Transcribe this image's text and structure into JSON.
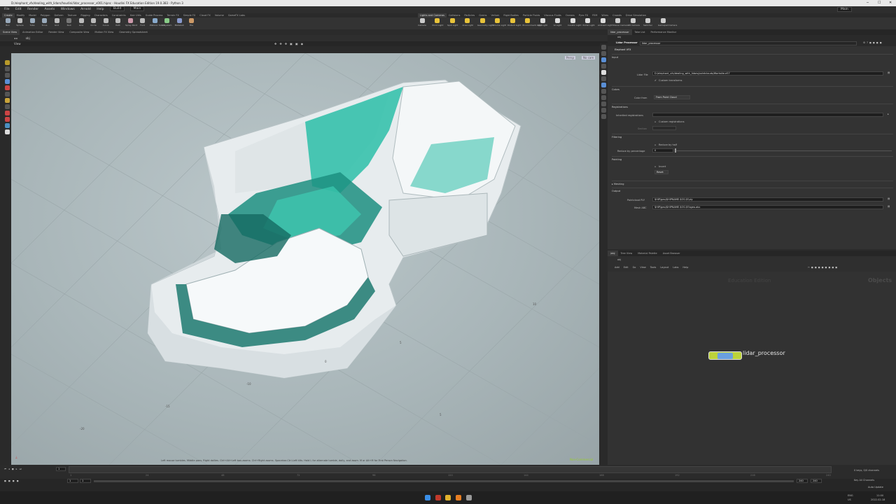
{
  "titlebar": {
    "title": "D:/elephant_vfx/dealing_with_lidars/houdini/lidar_processor_v001.hipnc - Houdini FX Education Edition 19.0.383 - Python 3"
  },
  "menubar": {
    "items": [
      "File",
      "Edit",
      "Render",
      "Assets",
      "Windows",
      "Arnold",
      "Help"
    ],
    "build_label": "Build",
    "desktop_label": "Main",
    "right_desktop": "Main"
  },
  "shelf": {
    "left_tabs": [
      "Create",
      "Modify",
      "Model",
      "Polygon",
      "Deform",
      "Texture",
      "Rigging",
      "Characters",
      "Constraints",
      "Hair Utils",
      "Guide Process",
      "Terrain FX",
      "Simple FX",
      "Cloud FX",
      "Volume",
      "GameFX Labs"
    ],
    "right_tabs": [
      "Lights and Cameras",
      "Collisions",
      "Particles",
      "Grains",
      "Vellum",
      "Rigid Bodies",
      "Particle Fluids",
      "Viscous Fluids",
      "Oceans",
      "Pyro FX",
      "FEM",
      "Wires",
      "Crowds",
      "Drive Simulation"
    ],
    "left_tools": [
      "Box",
      "Sphere",
      "Tube",
      "Torus",
      "Grid",
      "Null",
      "Line",
      "Circle",
      "Curve",
      "Path",
      "Spray Paint",
      "Font",
      "Platonic Solids",
      "L-System",
      "Metaball",
      "File"
    ],
    "right_tools": [
      "Camera",
      "Point Light",
      "Spot Light",
      "Area Light",
      "Geometry Light",
      "Volume Light",
      "Distant Light",
      "Environment Light",
      "Sky Light",
      "GI Light",
      "Caustic Light",
      "Portal Light",
      "Ambient Light",
      "Stereo Camera",
      "VR Camera",
      "Switcher",
      "Gamepad Camera"
    ]
  },
  "left_pane_tabs": [
    "Scene View",
    "Animation Editor",
    "Render View",
    "Composite View",
    "Motion FX View",
    "Geometry Spreadsheet"
  ],
  "viewport": {
    "path": "obj",
    "view_label": "View",
    "persp_label": "Persp",
    "cam_label": "No cam",
    "grid_labels": [
      "10",
      "5",
      "0",
      "5",
      "-10",
      "-15",
      "-20"
    ],
    "hint": "Left mouse tumbles. Middle pans. Right dollies. Ctrl+Alt+Left box-zooms. Ctrl+Right zooms. Spacebar-Ctrl-Left tilts. Hold L for alternate tumble, dolly, and zoom.    M or Alt+M for First Person Navigation.",
    "indicator": "Non-Commercial"
  },
  "right_pane_tabs": [
    "lidar_processor",
    "Take List",
    "Performance Monitor"
  ],
  "parameters": {
    "path": "obj",
    "node_type": "Lidar Processor",
    "node_name": "lidar_processor",
    "header": "Elephant VFX",
    "input_label": "Input",
    "lidar_file_label": "Lidar File",
    "lidar_file": "D:/elephant_vfx/dealing_with_lidars/pointclouds/Worksite.e57",
    "custom_transforms": "Custom transforms",
    "colors_label": "Colors",
    "color_from_label": "Color from",
    "color_from": "From Point Cloud",
    "registrations_label": "Registrations",
    "inherited_label": "Inherited registrations",
    "custom_registrations": "Custom registrations",
    "section_label": "Section",
    "filtering_label": "Filtering",
    "reduce_half": "Reduce by half",
    "reduce_pct_label": "Reduce by percentage",
    "reduce_pct_value": "0",
    "painting_label": "Painting",
    "invert_label": "Invert",
    "reset_label": "Reset",
    "meshing_label": "Meshing",
    "output_label": "Output",
    "ply_label": "Pointcloud PLY",
    "ply_value": "$HIP/geo/$HIPNAME.$OS.$F.ply",
    "abc_label": "Mesh ABC",
    "abc_value": "$HIP/geo/$HIPNAME.$OS.$F.bgeo.abc"
  },
  "network": {
    "tabs": [
      "/obj",
      "Tree View",
      "Material Palette",
      "Asset Browser"
    ],
    "path": "obj",
    "menu": [
      "Add",
      "Edit",
      "Go",
      "View",
      "Tools",
      "Layout",
      "Labs",
      "Help"
    ],
    "watermark": "Education Edition",
    "context": "Objects",
    "node_label": "lidar_processor"
  },
  "timeline": {
    "frame": "1",
    "start": "1",
    "start2": "1",
    "end": "240",
    "end2": "240",
    "ticks": [
      "1",
      "24",
      "48",
      "72",
      "96",
      "120",
      "144",
      "168",
      "192",
      "216",
      "240"
    ],
    "keys_label": "0 keys, 0/0 channels",
    "key_all": "Key All Channels",
    "auto_update": "Auto Update"
  },
  "taskbar": {
    "lang": "ENG",
    "region": "US",
    "time": "11:00",
    "date": "2022-02-18"
  }
}
